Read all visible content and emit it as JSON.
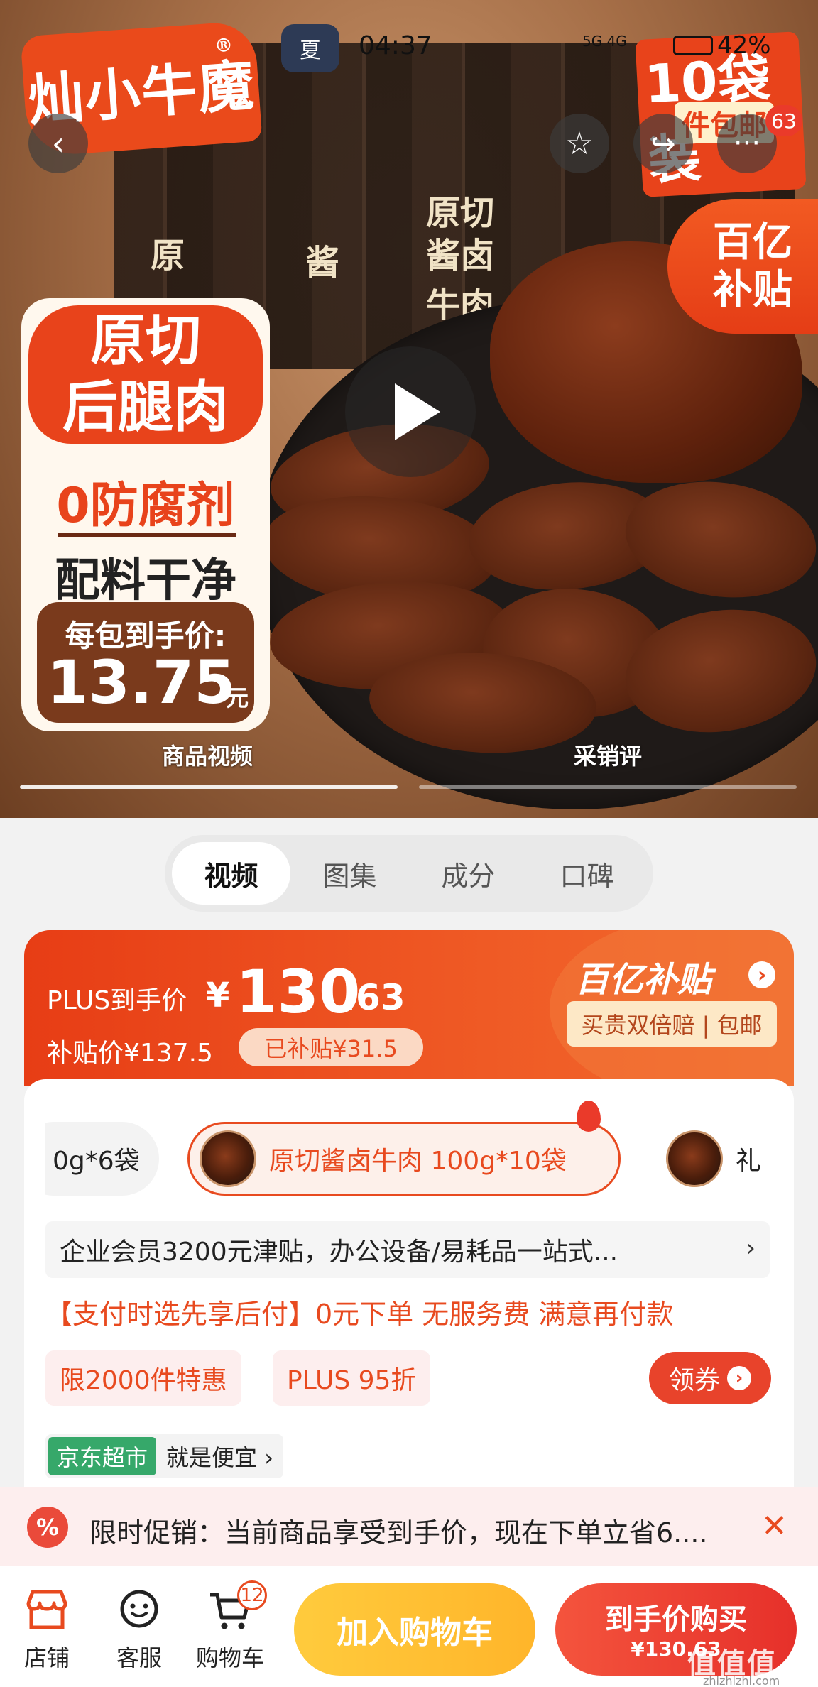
{
  "status_bar": {
    "time": "04:37",
    "network": "5G 4G",
    "battery": "42%",
    "app_icon_glyph": "夏"
  },
  "hero": {
    "brand_logo_text": "灿小牛魔",
    "brand_reg": "®",
    "promo_top_big": "10袋装",
    "promo_top_sub": "件包邮",
    "notification_count": "63",
    "pack_labels": [
      "原",
      "酱",
      "原切",
      "酱卤",
      "牛肉"
    ],
    "subsidy_tag_line1": "百亿",
    "subsidy_tag_line2": "补贴",
    "panel_title_line1": "原切",
    "panel_title_line2": "后腿肉",
    "panel_feature1": "0防腐剂",
    "panel_feature2": "配料干净",
    "panel_price_label": "每包到手价:",
    "panel_price_value": "13.75",
    "panel_price_unit": "元",
    "caption_left": "商品视频",
    "caption_right": "采销评"
  },
  "tabs": [
    {
      "label": "视频",
      "active": true
    },
    {
      "label": "图集",
      "active": false
    },
    {
      "label": "成分",
      "active": false
    },
    {
      "label": "口碑",
      "active": false
    }
  ],
  "price_card": {
    "plus_label": "PLUS到手价",
    "yen": "¥",
    "price_int": "130",
    "price_dec": ".63",
    "subsidy_price": "补贴价¥137.5",
    "subsidized_chip": "已补贴¥31.5",
    "subsidy_brand": "百亿补贴",
    "guarantee_tag": "买贵双倍赔 | 包邮"
  },
  "variants": [
    {
      "label": "0g*6袋",
      "active": false
    },
    {
      "label": "原切酱卤牛肉 100g*10袋",
      "active": true
    },
    {
      "label": "礼",
      "active": false
    }
  ],
  "enterprise_banner": "企业会员3200元津贴，办公设备/易耗品一站式...",
  "pay_later": "【支付时选先享后付】0元下单 无服务费 满意再付款",
  "chips": {
    "limit": "限2000件特惠",
    "plus_discount": "PLUS 95折",
    "coupon_label": "领券"
  },
  "jd": {
    "tag": "京东超市",
    "text": "就是便宜 ›"
  },
  "promo_banner": {
    "icon_glyph": "%",
    "text": "限时促销：当前商品享受到手价，现在下单立省6...."
  },
  "bottom_bar": {
    "shop_label": "店铺",
    "service_label": "客服",
    "cart_label": "购物车",
    "cart_count": "12",
    "add_to_cart": "加入购物车",
    "buy_now": "到手价购买",
    "buy_now_price": "¥130.63"
  },
  "watermark": {
    "main": "值值值",
    "sub": "zhizhizhi.com"
  },
  "colors": {
    "accent": "#e84a1f",
    "buy_red": "#e6302a",
    "add_cart_yellow": "#ffb52a",
    "jd_green": "#36a86a"
  }
}
